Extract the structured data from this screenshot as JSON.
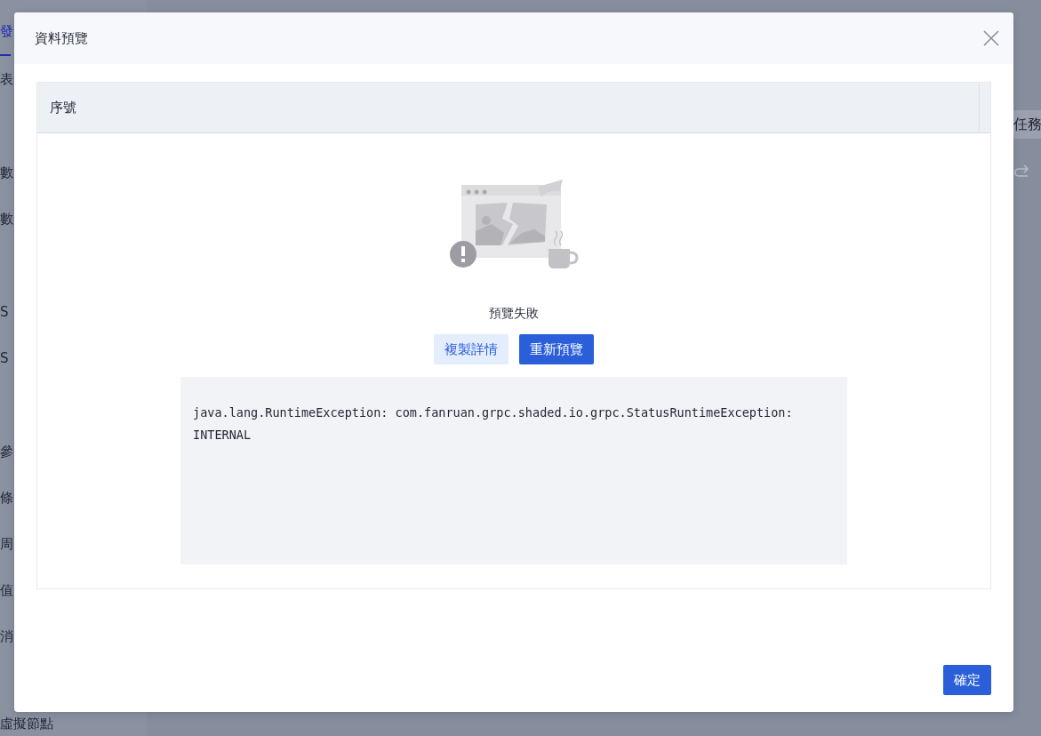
{
  "background": {
    "sidebar_sections": [
      [
        {
          "label": "發",
          "selected": true
        },
        {
          "label": "表",
          "selected": false
        }
      ],
      [
        {
          "label": "數",
          "selected": false
        },
        {
          "label": "數",
          "selected": false
        }
      ],
      [
        {
          "label": "S",
          "selected": false
        },
        {
          "label": "S",
          "selected": false
        }
      ],
      [
        {
          "label": "參",
          "selected": false
        },
        {
          "label": "條",
          "selected": false
        },
        {
          "label": "周",
          "selected": false
        },
        {
          "label": "值",
          "selected": false
        },
        {
          "label": "消",
          "selected": false
        },
        {
          "label": "虛擬節點",
          "selected": false
        }
      ]
    ],
    "right_label": "任務"
  },
  "dialog": {
    "title": "資料預覽",
    "table": {
      "columns": [
        "序號"
      ]
    },
    "empty_state": {
      "message": "預覽失敗",
      "buttons": [
        {
          "label": "複製詳情",
          "kind": "secondary"
        },
        {
          "label": "重新預覽",
          "kind": "primary"
        }
      ],
      "error_detail": "java.lang.RuntimeException: com.fanruan.grpc.shaded.io.grpc.StatusRuntimeException: INTERNAL"
    },
    "footer_buttons": [
      {
        "label": "確定",
        "kind": "primary"
      }
    ]
  }
}
